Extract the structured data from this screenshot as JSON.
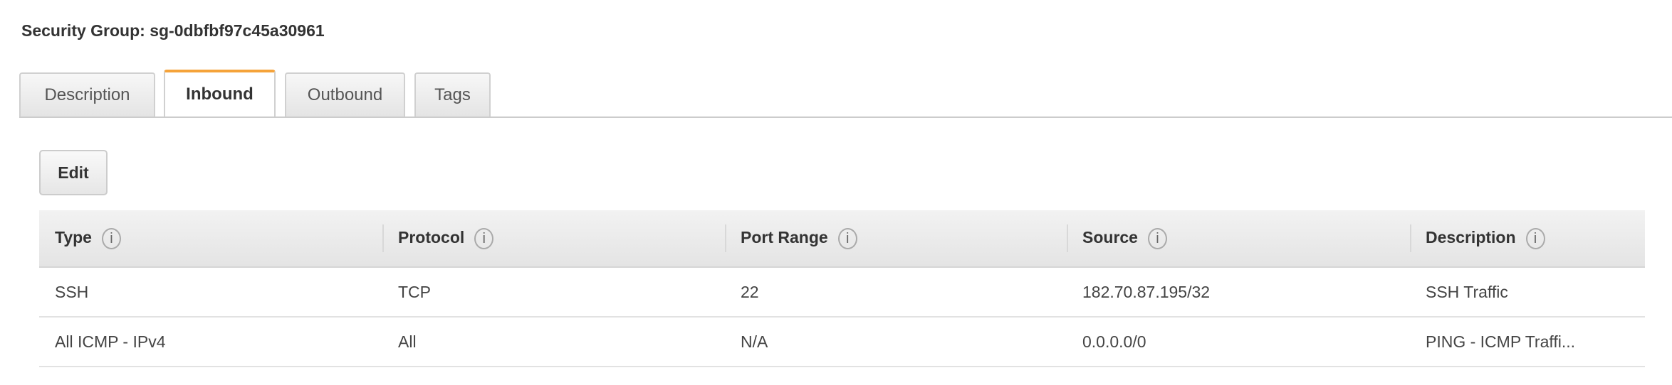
{
  "title": "Security Group: sg-0dbfbf97c45a30961",
  "tabs": [
    {
      "label": "Description",
      "active": false
    },
    {
      "label": "Inbound",
      "active": true
    },
    {
      "label": "Outbound",
      "active": false
    },
    {
      "label": "Tags",
      "active": false
    }
  ],
  "accent_color": "#f5a33a",
  "edit_label": "Edit",
  "table": {
    "headers": [
      "Type",
      "Protocol",
      "Port Range",
      "Source",
      "Description"
    ],
    "info_icon": "i",
    "rows": [
      [
        "SSH",
        "TCP",
        "22",
        "182.70.87.195/32",
        "SSH Traffic"
      ],
      [
        "All ICMP - IPv4",
        "All",
        "N/A",
        "0.0.0.0/0",
        "PING - ICMP Traffi..."
      ]
    ]
  }
}
